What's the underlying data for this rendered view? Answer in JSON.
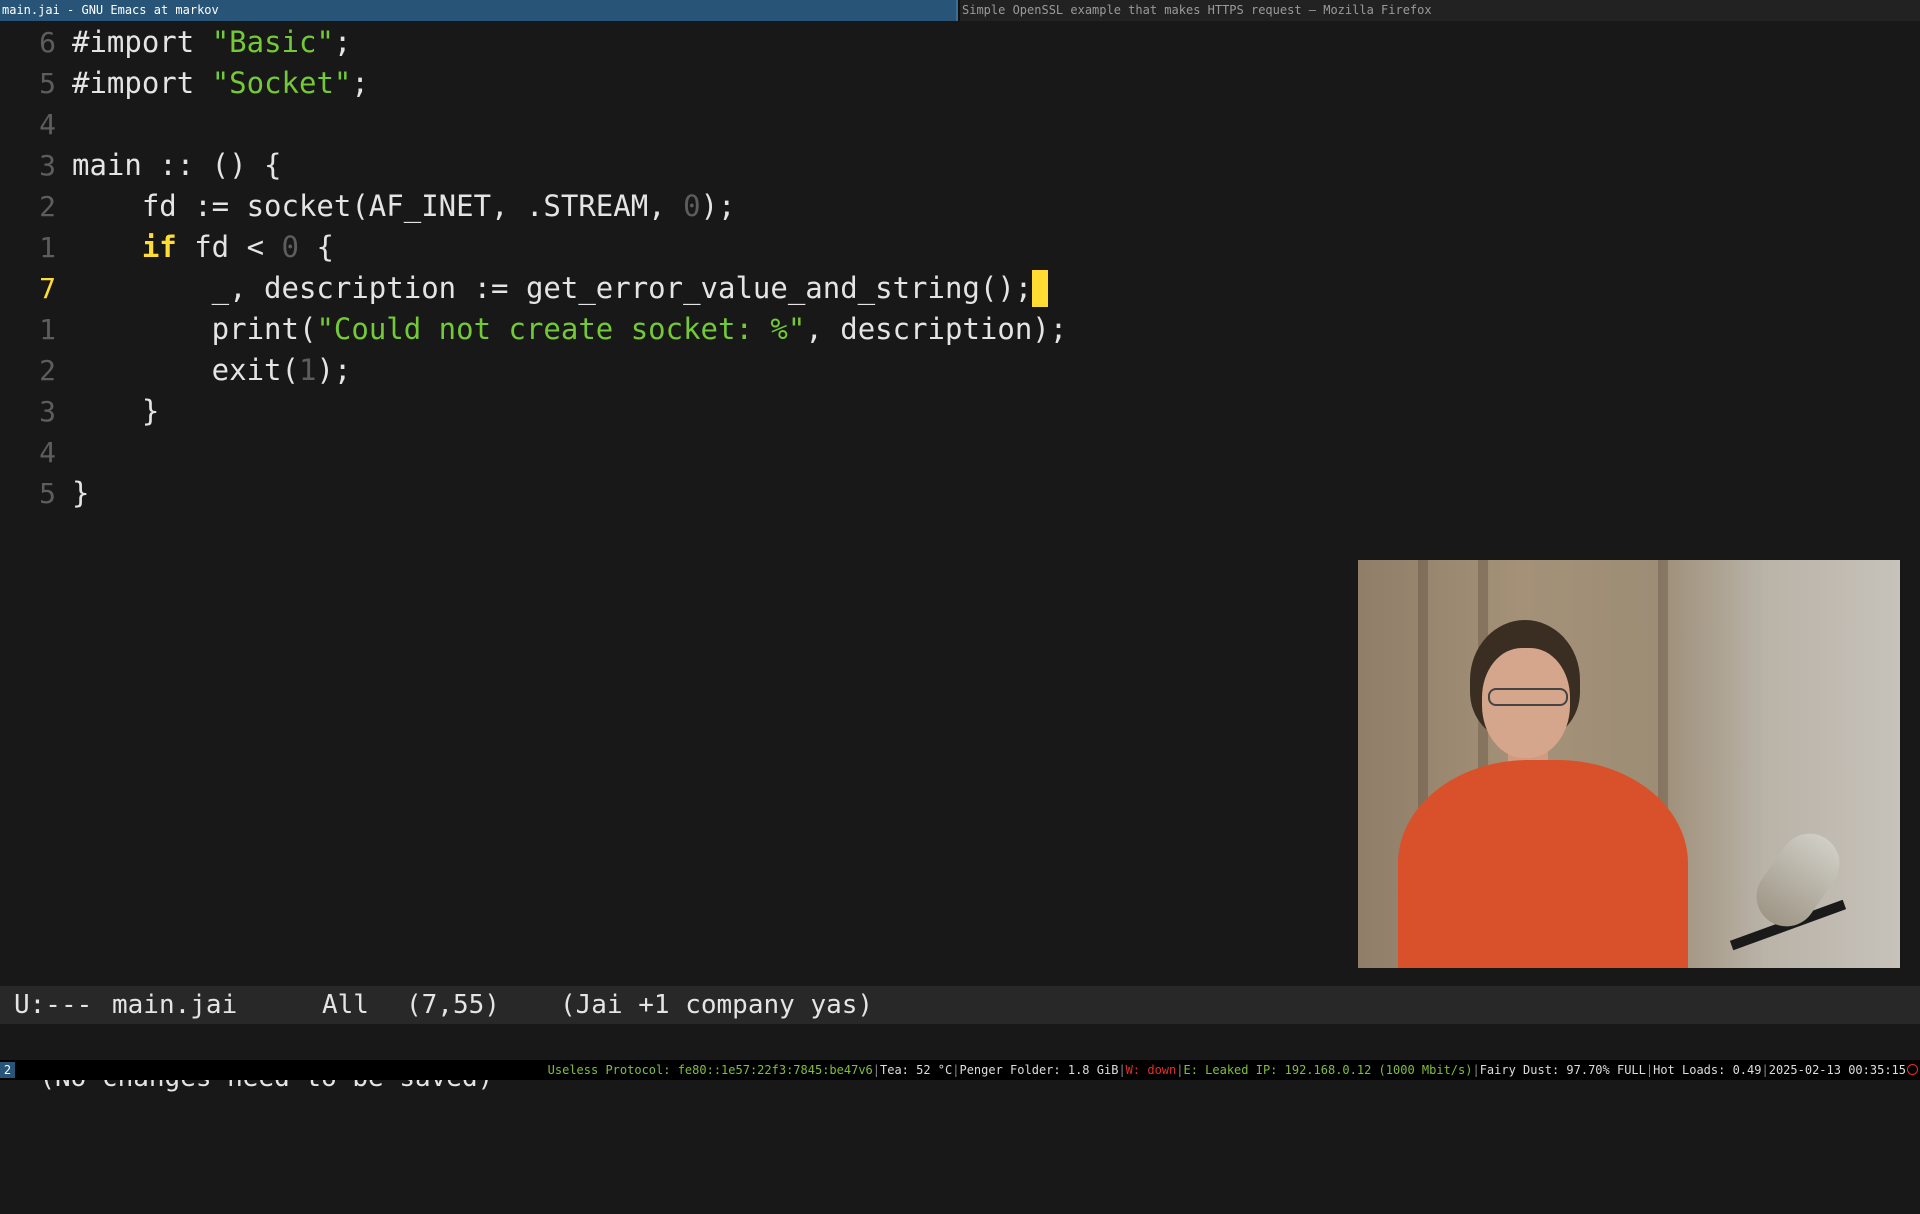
{
  "window_tabs": {
    "active": "main.jai - GNU Emacs at markov",
    "inactive": "Simple OpenSSL example that makes HTTPS request — Mozilla Firefox"
  },
  "editor": {
    "lines": [
      {
        "num": "6",
        "current": false,
        "segments": [
          {
            "t": "#import ",
            "c": "plain"
          },
          {
            "t": "\"Basic\"",
            "c": "str"
          },
          {
            "t": ";",
            "c": "plain"
          }
        ]
      },
      {
        "num": "5",
        "current": false,
        "segments": [
          {
            "t": "#import ",
            "c": "plain"
          },
          {
            "t": "\"Socket\"",
            "c": "str"
          },
          {
            "t": ";",
            "c": "plain"
          }
        ]
      },
      {
        "num": "4",
        "current": false,
        "segments": []
      },
      {
        "num": "3",
        "current": false,
        "segments": [
          {
            "t": "main :: () {",
            "c": "plain"
          }
        ]
      },
      {
        "num": "2",
        "current": false,
        "segments": [
          {
            "t": "    fd := socket(AF_INET, .STREAM, ",
            "c": "plain"
          },
          {
            "t": "0",
            "c": "num"
          },
          {
            "t": ");",
            "c": "plain"
          }
        ]
      },
      {
        "num": "1",
        "current": false,
        "segments": [
          {
            "t": "    ",
            "c": "plain"
          },
          {
            "t": "if",
            "c": "kw"
          },
          {
            "t": " fd < ",
            "c": "plain"
          },
          {
            "t": "0",
            "c": "num"
          },
          {
            "t": " {",
            "c": "plain"
          }
        ]
      },
      {
        "num": "7",
        "current": true,
        "cursor": true,
        "segments": [
          {
            "t": "        _, description := get_error_value_and_string();",
            "c": "plain"
          }
        ]
      },
      {
        "num": "1",
        "current": false,
        "segments": [
          {
            "t": "        print(",
            "c": "plain"
          },
          {
            "t": "\"Could not create socket: %\"",
            "c": "str"
          },
          {
            "t": ", description);",
            "c": "plain"
          }
        ]
      },
      {
        "num": "2",
        "current": false,
        "segments": [
          {
            "t": "        exit(",
            "c": "plain"
          },
          {
            "t": "1",
            "c": "num"
          },
          {
            "t": ");",
            "c": "plain"
          }
        ]
      },
      {
        "num": "3",
        "current": false,
        "segments": [
          {
            "t": "    }",
            "c": "plain"
          }
        ]
      },
      {
        "num": "4",
        "current": false,
        "segments": []
      },
      {
        "num": "5",
        "current": false,
        "segments": [
          {
            "t": "}",
            "c": "plain"
          }
        ]
      }
    ]
  },
  "modeline": {
    "state": "U:---",
    "buffer": "main.jai",
    "scroll": "All",
    "position": "(7,55)",
    "modes": "(Jai +1 company yas)"
  },
  "minibuffer": {
    "message": "(No changes need to be saved)"
  },
  "statusbar": {
    "workspace": "2",
    "protocol": "Useless Protocol: fe80::1e57:22f3:7845:be47v6",
    "tea": "Tea: 52 °C",
    "folder": "Penger Folder: 1.8 GiB",
    "wifi": "W: down",
    "ethernet": "E: Leaked IP: 192.168.0.12 (1000 Mbit/s)",
    "dust": "Fairy Dust: 97.70% FULL",
    "loads": "Hot Loads: 0.49",
    "datetime": "2025-02-13 00:35:15"
  },
  "colors": {
    "background": "#181818",
    "keyword": "#ffdd33",
    "string": "#73c936",
    "line_number": "#5d5d5d",
    "cursor": "#ffdd33",
    "active_tab": "#285577",
    "status_ok": "#7fbf3f",
    "status_bad": "#e0302a"
  }
}
